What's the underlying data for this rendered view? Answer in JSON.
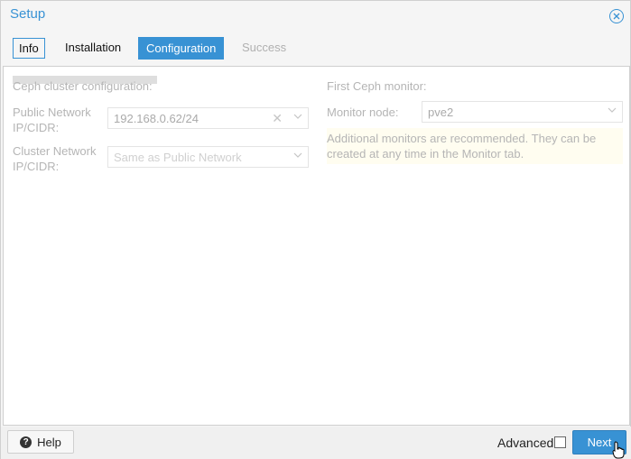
{
  "window": {
    "title": "Setup"
  },
  "tabs": [
    {
      "label": "Info"
    },
    {
      "label": "Installation"
    },
    {
      "label": "Configuration"
    },
    {
      "label": "Success"
    }
  ],
  "left": {
    "section_title": "Ceph cluster configuration:",
    "public_network_label": "Public Network IP/CIDR:",
    "public_network_value": "192.168.0.62/24",
    "cluster_network_label": "Cluster Network IP/CIDR:",
    "cluster_network_placeholder": "Same as Public Network"
  },
  "right": {
    "section_title": "First Ceph monitor:",
    "monitor_node_label": "Monitor node:",
    "monitor_node_value": "pve2",
    "note": "Additional monitors are recommended. They can be created at any time in the Monitor tab."
  },
  "footer": {
    "help_label": "Help",
    "advanced_label": "Advanced",
    "next_label": "Next"
  },
  "colors": {
    "accent": "#3892d4"
  }
}
